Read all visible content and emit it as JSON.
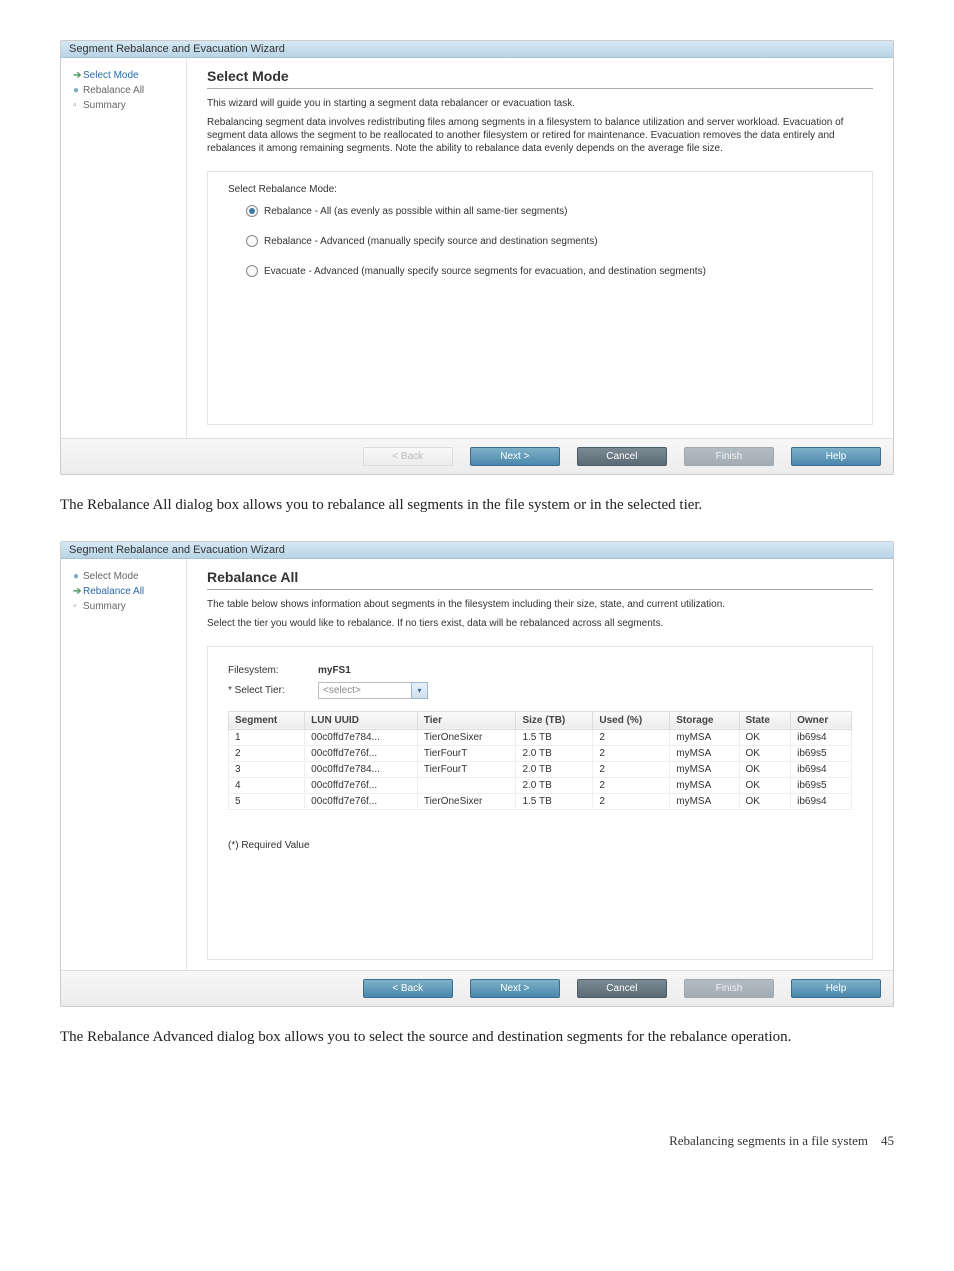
{
  "wizard_title": "Segment Rebalance and Evacuation Wizard",
  "steps": [
    "Select Mode",
    "Rebalance All",
    "Summary"
  ],
  "buttons": {
    "back": "< Back",
    "next": "Next >",
    "cancel": "Cancel",
    "finish": "Finish",
    "help": "Help"
  },
  "select_mode": {
    "title": "Select Mode",
    "intro": "This wizard will guide you in starting a segment data rebalancer or evacuation task.",
    "desc": "Rebalancing segment data involves redistributing files among segments in a filesystem to balance utilization and server workload. Evacuation of segment data allows the segment to be reallocated to another filesystem or retired for maintenance. Evacuation removes the data entirely and rebalances it among remaining segments. Note the ability to rebalance data evenly depends on the average file size.",
    "section_label": "Select Rebalance Mode:",
    "options": [
      {
        "label": "Rebalance - All (as evenly as possible within all same-tier segments)",
        "selected": true
      },
      {
        "label": "Rebalance - Advanced (manually specify source and destination segments)",
        "selected": false
      },
      {
        "label": "Evacuate - Advanced (manually specify source segments for evacuation, and destination segments)",
        "selected": false
      }
    ]
  },
  "caption1": "The Rebalance All dialog box allows you to rebalance all segments in the file system or in the selected tier.",
  "rebalance_all": {
    "title": "Rebalance All",
    "intro": "The table below shows information about segments in the filesystem including their size, state, and current utilization.",
    "desc": "Select the tier you would like to rebalance. If no tiers exist, data will be rebalanced across all segments.",
    "filesystem_label": "Filesystem:",
    "filesystem_value": "myFS1",
    "select_tier_label": "* Select Tier:",
    "select_tier_placeholder": "<select>",
    "columns": [
      "Segment",
      "LUN UUID",
      "Tier",
      "Size (TB)",
      "Used (%)",
      "Storage",
      "State",
      "Owner"
    ],
    "rows": [
      {
        "segment": "1",
        "uuid": "00c0ffd7e784...",
        "tier": "TierOneSixer",
        "size": "1.5 TB",
        "used": "2",
        "storage": "myMSA",
        "state": "OK",
        "owner": "ib69s4"
      },
      {
        "segment": "2",
        "uuid": "00c0ffd7e76f...",
        "tier": "TierFourT",
        "size": "2.0 TB",
        "used": "2",
        "storage": "myMSA",
        "state": "OK",
        "owner": "ib69s5"
      },
      {
        "segment": "3",
        "uuid": "00c0ffd7e784...",
        "tier": "TierFourT",
        "size": "2.0 TB",
        "used": "2",
        "storage": "myMSA",
        "state": "OK",
        "owner": "ib69s4"
      },
      {
        "segment": "4",
        "uuid": "00c0ffd7e76f...",
        "tier": "",
        "size": "2.0 TB",
        "used": "2",
        "storage": "myMSA",
        "state": "OK",
        "owner": "ib69s5"
      },
      {
        "segment": "5",
        "uuid": "00c0ffd7e76f...",
        "tier": "TierOneSixer",
        "size": "1.5 TB",
        "used": "2",
        "storage": "myMSA",
        "state": "OK",
        "owner": "ib69s4"
      }
    ],
    "required_note": "(*) Required Value"
  },
  "caption2": "The Rebalance Advanced dialog box allows you to select the source and destination segments for the rebalance operation.",
  "footer": {
    "text": "Rebalancing segments in a file system",
    "page": "45"
  }
}
